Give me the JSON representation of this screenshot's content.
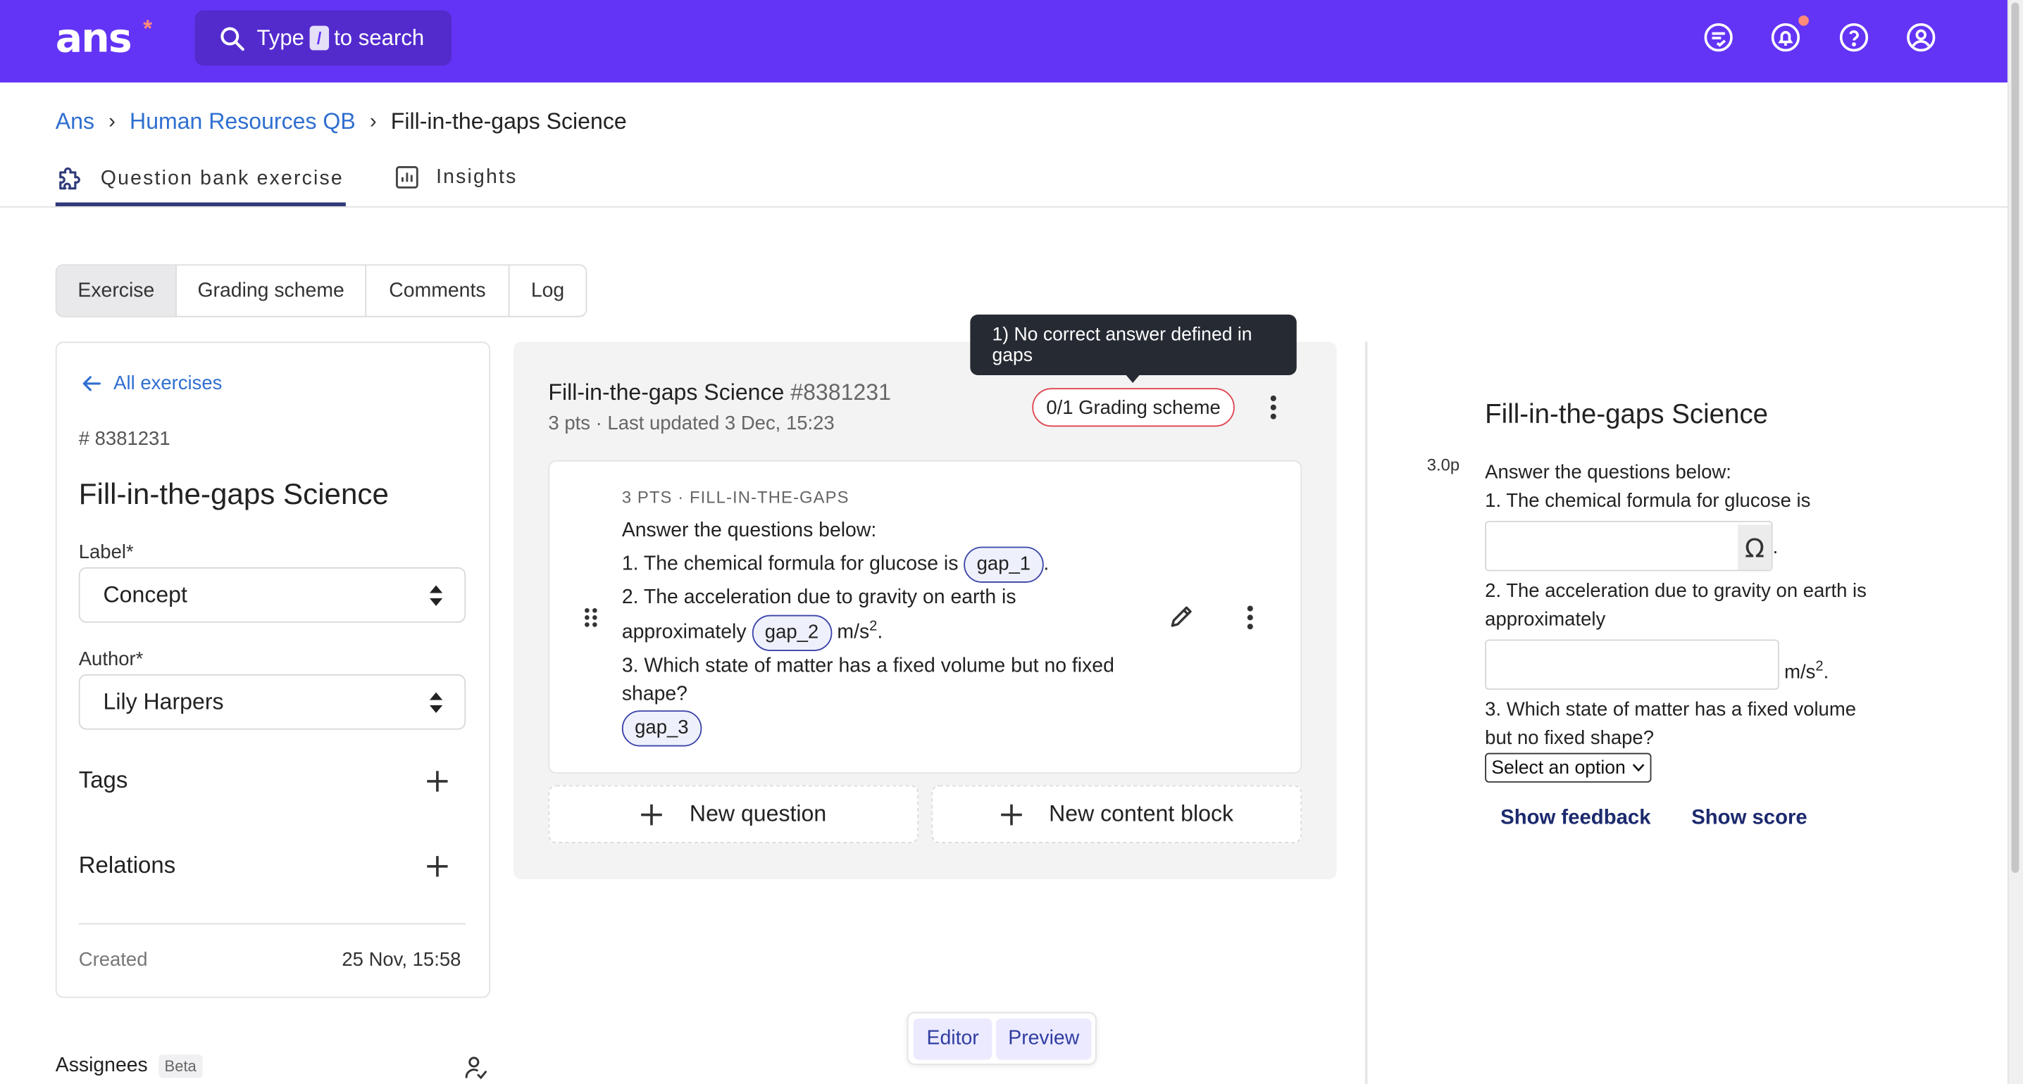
{
  "app": {
    "logo": "ans",
    "logo_star": "*",
    "search_prefix": "Type",
    "search_key": "/",
    "search_suffix": "to search"
  },
  "topbar_icons": [
    "chat-icon",
    "bell-icon",
    "help-icon",
    "account-icon"
  ],
  "colors": {
    "brand": "#6334f5",
    "link": "#2f6fd0",
    "error": "#e0454f",
    "notification": "#ff8a7a"
  },
  "breadcrumb": [
    "Ans",
    "Human Resources QB",
    "Fill-in-the-gaps Science"
  ],
  "page_tabs": [
    "Question bank exercise",
    "Insights"
  ],
  "segment_tabs": [
    "Exercise",
    "Grading scheme",
    "Comments",
    "Log"
  ],
  "left": {
    "back": "All exercises",
    "id": "# 8381231",
    "title": "Fill-in-the-gaps Science",
    "label_field": "Label*",
    "label_value": "Concept",
    "author_field": "Author*",
    "author_value": "Lily Harpers",
    "tags": "Tags",
    "relations": "Relations",
    "created_label": "Created",
    "created_value": "25 Nov, 15:58",
    "assignees": "Assignees",
    "beta": "Beta"
  },
  "middle": {
    "title": "Fill-in-the-gaps Science",
    "number": "#8381231",
    "subtitle": "3 pts · Last updated 3 Dec, 15:23",
    "tooltip": "1) No correct answer defined in gaps",
    "grading_pill": "0/1 Grading scheme",
    "question": {
      "meta": "3 PTS · FILL-IN-THE-GAPS",
      "intro": "Answer the questions below:",
      "q1_text": "1. The chemical formula for glucose is",
      "gap1": "gap_1",
      "q2_text_a": "2. The acceleration due to gravity on earth is",
      "q2_text_b": "approximately",
      "gap2": "gap_2",
      "unit": "m/s",
      "unit_exp": "2",
      "q3_text_a": "3. Which state of matter has a fixed volume but no fixed",
      "q3_text_b": "shape?",
      "gap3": "gap_3"
    },
    "new_question": "New question",
    "new_content_block": "New content block"
  },
  "preview": {
    "title": "Fill-in-the-gaps Science",
    "points": "3.0p",
    "intro": "Answer the questions below:",
    "q1": "1. The chemical formula for glucose is",
    "omega": "Ω",
    "q2_a": "2. The acceleration due to gravity on earth is",
    "q2_b": "approximately",
    "unit": "m/s",
    "unit_exp": "2",
    "q3_a": "3. Which state of matter has a fixed volume",
    "q3_b": "but no fixed shape?",
    "select_value": "Select an option",
    "show_feedback": "Show feedback",
    "show_score": "Show score"
  },
  "toggle": {
    "editor": "Editor",
    "preview": "Preview"
  }
}
